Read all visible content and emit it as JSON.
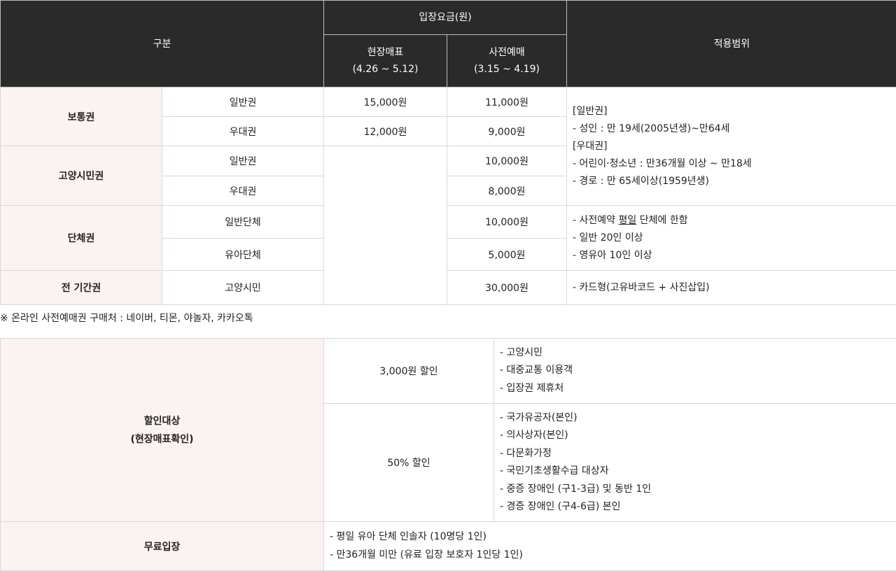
{
  "fee_table": {
    "headers": {
      "category": "구분",
      "admission_fee": "입장요금(원)",
      "onsite_title": "현장매표",
      "onsite_period": "(4.26 ~ 5.12)",
      "presale_title": "사전예매",
      "presale_period": "(3.15 ~ 4.19)",
      "scope": "적용범위"
    },
    "groups": [
      {
        "name": "보통권",
        "rows": [
          {
            "type": "일반권",
            "onsite": "15,000원",
            "presale": "11,000원"
          },
          {
            "type": "우대권",
            "onsite": "12,000원",
            "presale": "9,000원"
          }
        ]
      },
      {
        "name": "고양시민권",
        "rows": [
          {
            "type": "일반권",
            "presale": "10,000원"
          },
          {
            "type": "우대권",
            "presale": "8,000원"
          }
        ]
      },
      {
        "name": "단체권",
        "rows": [
          {
            "type": "일반단체",
            "presale": "10,000원"
          },
          {
            "type": "유아단체",
            "presale": "5,000원"
          }
        ]
      },
      {
        "name": "전 기간권",
        "rows": [
          {
            "type": "고양시민",
            "presale": "30,000원"
          }
        ]
      }
    ],
    "scope_general": {
      "h1": "[일반권]",
      "l1": "-  성인 : 만 19세(2005년생)~만64세",
      "h2": "[우대권]",
      "l2": "-  어린이·청소년 : 만36개월 이상 ~ 만18세",
      "l3": "-  경로 : 만 65세이상(1959년생)"
    },
    "scope_group": {
      "l1_pre": "-  사전예약 ",
      "l1_u": "평일",
      "l1_post": " 단체에 한함",
      "l2": "-  일반 20인 이상",
      "l3": "-  영유아 10인 이상"
    },
    "scope_season": "-  카드형(고유바코드 + 사진삽입)"
  },
  "note": "※   온라인 사전예매권 구매처 : 네이버, 티몬, 야놀자, 카카오톡",
  "discount_table": {
    "label_line1": "할인대상",
    "label_line2": "(현장매표확인)",
    "d1_amount": "3,000원 할인",
    "d1_items": [
      "-  고양시민",
      "-  대중교통 이용객",
      "-  입장권 제휴처"
    ],
    "d2_amount": "50% 할인",
    "d2_items": [
      "-  국가유공자(본인)",
      "-  의사상자(본인)",
      "-  다문화가정",
      "-  국민기초생활수급 대상자",
      "-  중증 장애인 (구1-3급) 및 동반 1인",
      "-  경증 장애인 (구4-6급) 본인"
    ],
    "free_label": "무료입장",
    "free_items": [
      "-  평일 유아 단체 인솔자 (10명당 1인)",
      "-  만36개월 미만 (유료 입장 보호자 1인당 1인)"
    ]
  }
}
